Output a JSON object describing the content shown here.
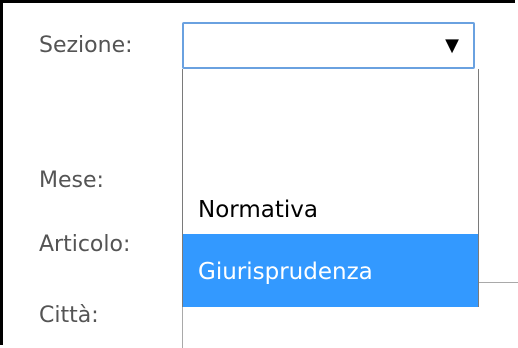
{
  "form": {
    "labels": {
      "sezione": "Sezione:",
      "mese": "Mese:",
      "articolo": "Articolo:",
      "citta": "Città:"
    },
    "sezione_select": {
      "selected_value": "",
      "arrow_icon": "triangle-down-icon"
    },
    "dropdown_options": [
      {
        "label": ""
      },
      {
        "label": "Normativa"
      },
      {
        "label": "Giurisprudenza",
        "highlighted": true
      }
    ]
  },
  "colors": {
    "highlight": "#3399ff",
    "focus_border": "#6aa1e0",
    "label_text": "#545454"
  }
}
